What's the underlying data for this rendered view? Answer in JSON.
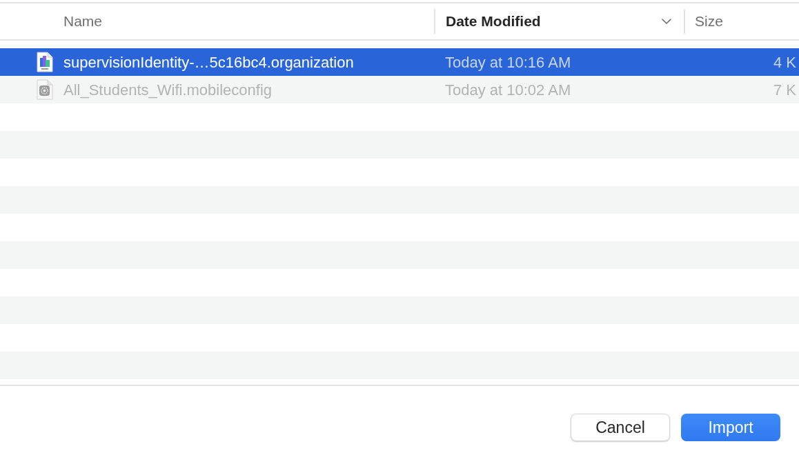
{
  "file_list": {
    "columns": [
      {
        "label": "Name",
        "sorted": false
      },
      {
        "label": "Date Modified",
        "sorted": true
      },
      {
        "label": "Size",
        "sorted": false
      }
    ],
    "rows": [
      {
        "kind": "organization",
        "name": "supervisionIdentity-…5c16bc4.organization",
        "date_modified": "Today at 10:16 AM",
        "size": "4 K",
        "selected": true,
        "disabled": false
      },
      {
        "kind": "config",
        "name": "All_Students_Wifi.mobileconfig",
        "date_modified": "Today at 10:02 AM",
        "size": "7 K",
        "selected": false,
        "disabled": true
      }
    ]
  },
  "buttons": [
    {
      "label": "Cancel",
      "kind": "secondary"
    },
    {
      "label": "Import",
      "kind": "primary"
    }
  ]
}
